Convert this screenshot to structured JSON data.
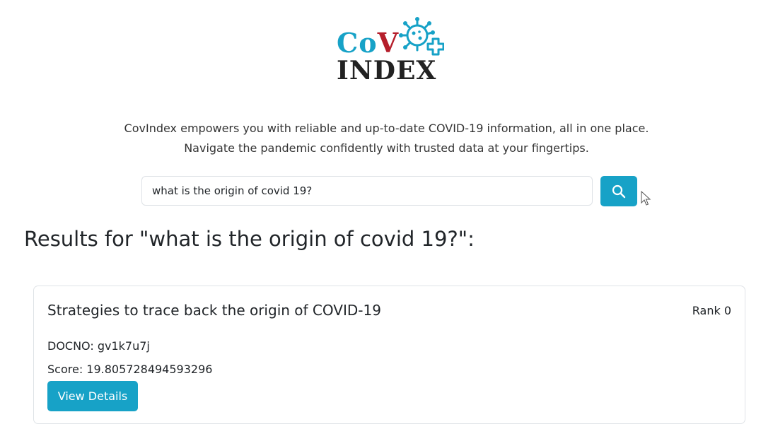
{
  "logo": {
    "line1_c": "C",
    "line1_o": "o",
    "line1_v": "V",
    "line2": "INDEX",
    "icon": "virus-plus-icon",
    "colors": {
      "primary": "#17a2c7",
      "accent": "#b51e2b",
      "dark": "#222222"
    }
  },
  "tagline": {
    "line1": "CovIndex empowers you with reliable and up-to-date COVID-19 information, all in one place.",
    "line2": "Navigate the pandemic confidently with trusted data at your fingertips."
  },
  "search": {
    "value": "what is the origin of covid 19?",
    "button_icon": "search-icon"
  },
  "results": {
    "heading": "Results for \"what is the origin of covid 19?\":",
    "items": [
      {
        "title": "Strategies to trace back the origin of COVID-19",
        "rank": "Rank 0",
        "docno": "DOCNO: gv1k7u7j",
        "score": "Score: 19.805728494593296",
        "button_label": "View Details"
      }
    ]
  },
  "theme": {
    "accent": "#17a2c7"
  }
}
